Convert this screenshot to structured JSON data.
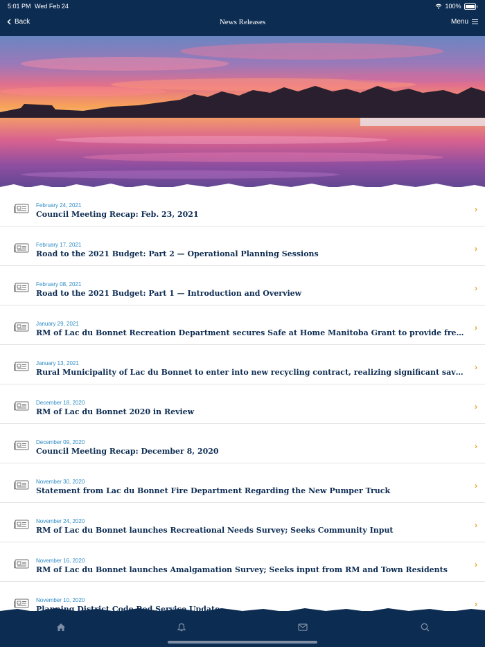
{
  "status": {
    "time": "5:01 PM",
    "date": "Wed Feb 24",
    "battery": "100%"
  },
  "nav": {
    "back_label": "Back",
    "title": "News Releases",
    "menu_label": "Menu"
  },
  "items": [
    {
      "date": "February 24, 2021",
      "title": "Council Meeting Recap: Feb. 23, 2021"
    },
    {
      "date": "February 17, 2021",
      "title": "Road to the 2021 Budget: Part 2 — Operational Planning Sessions"
    },
    {
      "date": "February 08, 2021",
      "title": "Road to the 2021 Budget: Part 1 — Introduction and Overview"
    },
    {
      "date": "January 29, 2021",
      "title": "RM of Lac du Bonnet Recreation Department secures Safe at Home Manitoba Grant to provide free virtua..."
    },
    {
      "date": "January 13, 2021",
      "title": "Rural Municipality of Lac du Bonnet to enter into new recycling contract, realizing significant savings"
    },
    {
      "date": "December 18, 2020",
      "title": "RM of Lac du Bonnet 2020 in Review"
    },
    {
      "date": "December 09, 2020",
      "title": "Council Meeting Recap: December 8, 2020"
    },
    {
      "date": "November 30, 2020",
      "title": "Statement from Lac du Bonnet Fire Department Regarding the New Pumper Truck"
    },
    {
      "date": "November 24, 2020",
      "title": "RM of Lac du Bonnet launches Recreational Needs Survey; Seeks Community Input"
    },
    {
      "date": "November 16, 2020",
      "title": "RM of Lac du Bonnet launches Amalgamation Survey; Seeks input from RM and Town Residents"
    },
    {
      "date": "November 10, 2020",
      "title": "Planning District Code Red Service Update"
    }
  ],
  "tabs": [
    "home-icon",
    "bell-icon",
    "mail-icon",
    "search-icon"
  ],
  "colors": {
    "navy": "#0d2c52",
    "date_blue": "#2b8ac4",
    "chevron": "#e6a429"
  }
}
